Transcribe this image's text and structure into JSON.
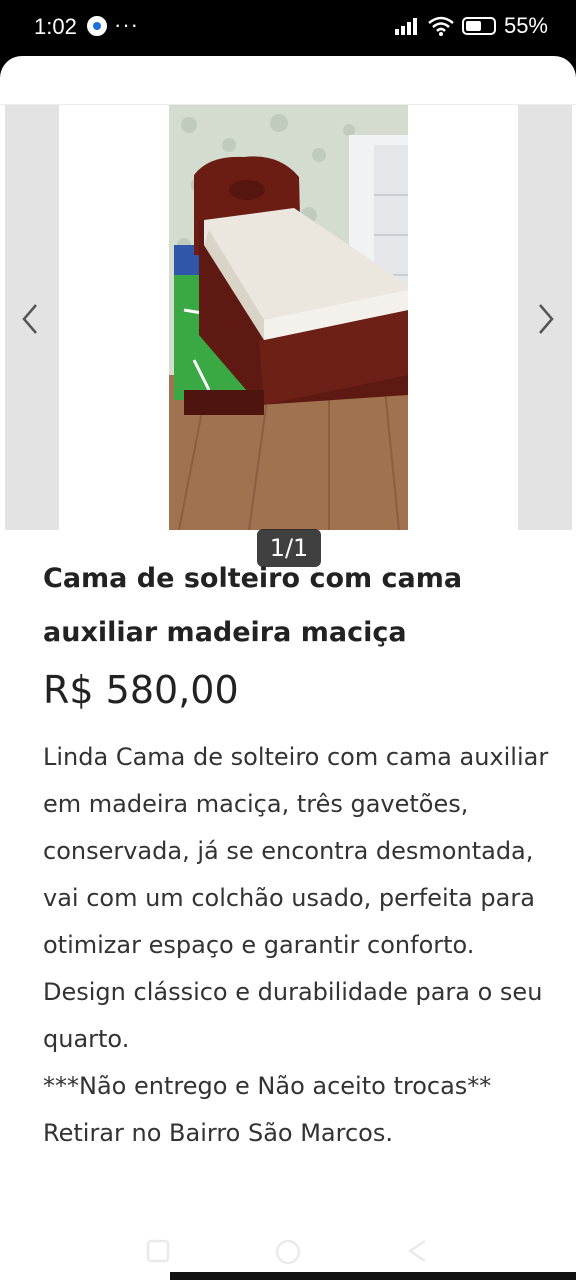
{
  "status_bar": {
    "time": "1:02",
    "more": "···",
    "battery": "55%"
  },
  "gallery": {
    "counter": "1/1"
  },
  "listing": {
    "title": "Cama de solteiro com cama auxiliar madeira maciça",
    "price": "R$ 580,00",
    "description": "Linda Cama de solteiro com cama auxiliar em madeira maciça, três gavetões, conservada, já se encontra desmontada, vai com um colchão usado, perfeita para otimizar espaço e garantir conforto. Design clássico e durabilidade para o seu quarto.\n***Não entrego e Não aceito trocas**\nRetirar no Bairro São Marcos."
  }
}
